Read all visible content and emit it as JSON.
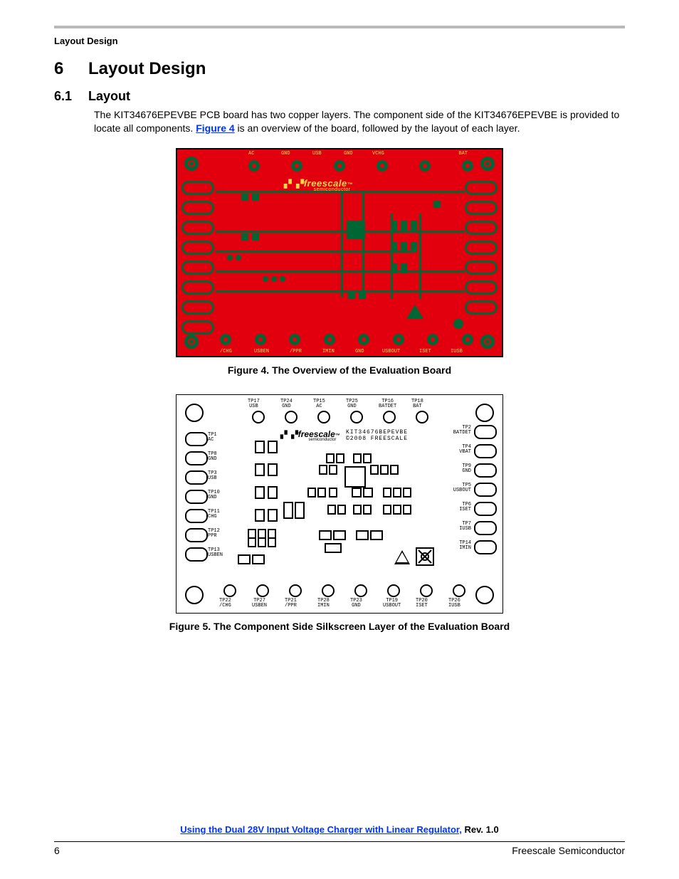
{
  "running_head": "Layout Design",
  "section": {
    "num": "6",
    "title": "Layout Design"
  },
  "subsection": {
    "num": "6.1",
    "title": "Layout"
  },
  "para": {
    "t1": "The KIT34676EPEVBE PCB board has two copper layers. The component side of the KIT34676EPEVBE is provided to locate all components. ",
    "link": "Figure 4",
    "t2": " is an overview of the board, followed by the layout of each layer."
  },
  "fig4": {
    "caption": "Figure 4. The Overview of the Evaluation Board"
  },
  "fig5": {
    "caption": "Figure 5. The Component Side Silkscreen Layer of the Evaluation Board"
  },
  "brand": {
    "name": "freescale",
    "tm": "™",
    "sub": "semiconductor"
  },
  "silk_text": {
    "partno": "KIT34676BEPEVBE",
    "copyright": "©2008 FREESCALE"
  },
  "silk_tp_top": [
    {
      "id": "TP17",
      "sig": "USB"
    },
    {
      "id": "TP24",
      "sig": "GND"
    },
    {
      "id": "TP15",
      "sig": "AC"
    },
    {
      "id": "TP25",
      "sig": "GND"
    },
    {
      "id": "TP16",
      "sig": "BATDET"
    },
    {
      "id": "TP18",
      "sig": "BAT"
    }
  ],
  "silk_tp_bottom": [
    {
      "id": "TP22",
      "sig": "/CHG"
    },
    {
      "id": "TP27",
      "sig": "USBEN"
    },
    {
      "id": "TP21",
      "sig": "/PPR"
    },
    {
      "id": "TP28",
      "sig": "IMIN"
    },
    {
      "id": "TP23",
      "sig": "GND"
    },
    {
      "id": "TP19",
      "sig": "USBOUT"
    },
    {
      "id": "TP20",
      "sig": "ISET"
    },
    {
      "id": "TP26",
      "sig": "IUSB"
    }
  ],
  "silk_left": [
    {
      "id": "TP1",
      "sig": "AC"
    },
    {
      "id": "TP8",
      "sig": "GND"
    },
    {
      "id": "TP3",
      "sig": "USB"
    },
    {
      "id": "TP10",
      "sig": "GND"
    },
    {
      "id": "TP11",
      "sig": "CHG"
    },
    {
      "id": "TP12",
      "sig": "PPR"
    },
    {
      "id": "TP13",
      "sig": "USBEN"
    }
  ],
  "silk_right": [
    {
      "id": "TP2",
      "sig": "BATDET"
    },
    {
      "id": "TP4",
      "sig": "VBAT"
    },
    {
      "id": "TP9",
      "sig": "GND"
    },
    {
      "id": "TP5",
      "sig": "USBOUT"
    },
    {
      "id": "TP6",
      "sig": "ISET"
    },
    {
      "id": "TP7",
      "sig": "IUSB"
    },
    {
      "id": "TP14",
      "sig": "IMIN"
    }
  ],
  "pcb_top_labels": [
    "AC",
    "GND",
    "USB",
    "GND",
    "VCHG",
    "",
    "",
    "",
    "BAT"
  ],
  "pcb_bottom_labels": [
    "/CHG",
    "USBEN",
    "/PPR",
    "IMIN",
    "GND",
    "USBOUT",
    "ISET",
    "IUSB"
  ],
  "footer": {
    "link": "Using the Dual 28V Input Voltage Charger with Linear Regulator,",
    "rev": " Rev. 1.0",
    "page": "6",
    "vendor": "Freescale Semiconductor"
  }
}
